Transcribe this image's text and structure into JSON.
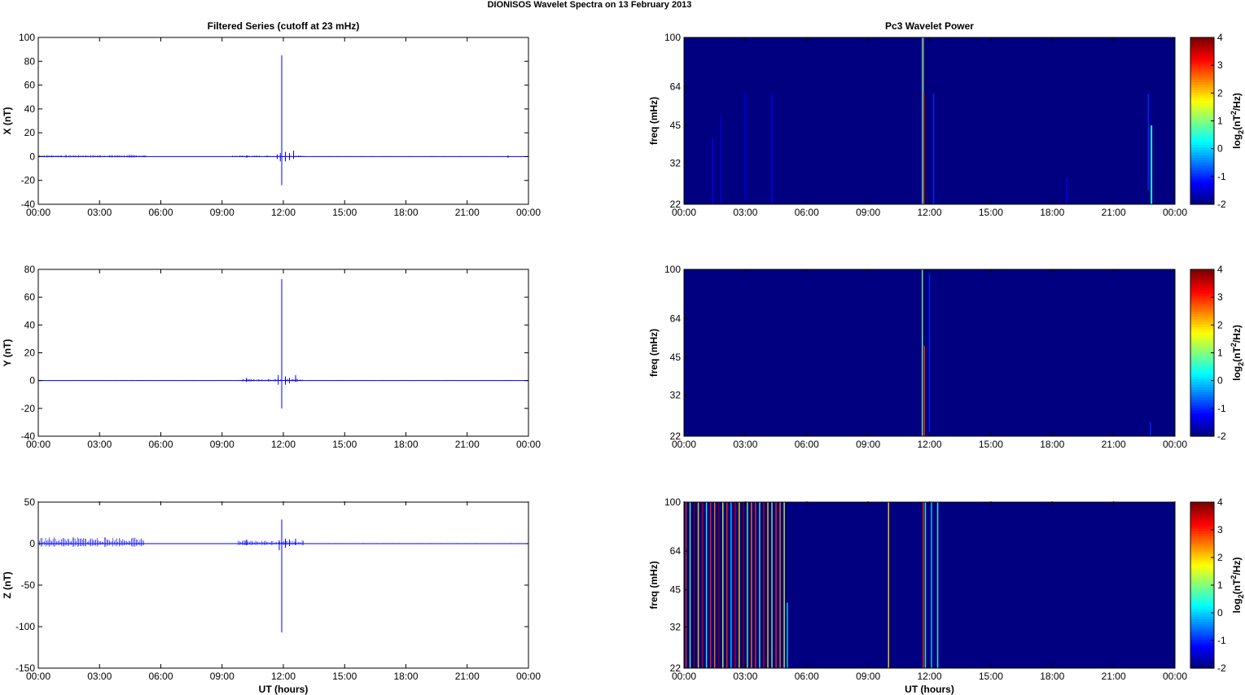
{
  "figure_title": "DIONISOS Wavelet Spectra on 13 February  2013",
  "chart_data": [
    {
      "id": "x-series",
      "type": "line",
      "title": "Filtered Series (cutoff at 23 mHz)",
      "xlabel": "",
      "ylabel": "X (nT)",
      "xlim": [
        0,
        24
      ],
      "ylim": [
        -40,
        100
      ],
      "xticks": [
        "00:00",
        "03:00",
        "06:00",
        "09:00",
        "12:00",
        "15:00",
        "18:00",
        "21:00",
        "00:00"
      ],
      "yticks": [
        -40,
        -20,
        0,
        20,
        40,
        60,
        80,
        100
      ],
      "color": "#0000ff",
      "baseline": 0,
      "spikes": [
        {
          "x": 11.92,
          "min": -24,
          "max": 85
        },
        {
          "x": 11.85,
          "min": -4,
          "max": 3
        },
        {
          "x": 12.1,
          "min": -4,
          "max": 4
        },
        {
          "x": 12.3,
          "min": -3,
          "max": 3
        },
        {
          "x": 12.5,
          "min": -2,
          "max": 5
        },
        {
          "x": 11.7,
          "min": -2,
          "max": 2
        },
        {
          "x": 10.2,
          "min": -1,
          "max": 1
        },
        {
          "x": 23.0,
          "min": -1,
          "max": 1
        }
      ],
      "noise": [
        {
          "from": 0,
          "to": 5.3,
          "amp": 1.2
        },
        {
          "from": 9.5,
          "to": 13,
          "amp": 0.8
        },
        {
          "from": 13,
          "to": 24,
          "amp": 0.3
        }
      ]
    },
    {
      "id": "y-series",
      "type": "line",
      "title": "",
      "xlabel": "",
      "ylabel": "Y (nT)",
      "xlim": [
        0,
        24
      ],
      "ylim": [
        -40,
        80
      ],
      "xticks": [
        "00:00",
        "03:00",
        "06:00",
        "09:00",
        "12:00",
        "15:00",
        "18:00",
        "21:00",
        "00:00"
      ],
      "yticks": [
        -40,
        -20,
        0,
        20,
        40,
        60,
        80
      ],
      "color": "#0000ff",
      "baseline": 0,
      "spikes": [
        {
          "x": 11.92,
          "min": -20,
          "max": 73
        },
        {
          "x": 11.75,
          "min": -3,
          "max": 4
        },
        {
          "x": 12.1,
          "min": -3,
          "max": 3
        },
        {
          "x": 12.3,
          "min": -2,
          "max": 2
        },
        {
          "x": 12.6,
          "min": -1,
          "max": 4
        },
        {
          "x": 10.2,
          "min": -1,
          "max": 2
        }
      ],
      "noise": [
        {
          "from": 0,
          "to": 24,
          "amp": 0.3
        },
        {
          "from": 10,
          "to": 13,
          "amp": 1.0
        }
      ]
    },
    {
      "id": "z-series",
      "type": "line",
      "title": "",
      "xlabel": "UT (hours)",
      "ylabel": "Z (nT)",
      "xlim": [
        0,
        24
      ],
      "ylim": [
        -150,
        50
      ],
      "xticks": [
        "00:00",
        "03:00",
        "06:00",
        "09:00",
        "12:00",
        "15:00",
        "18:00",
        "21:00",
        "00:00"
      ],
      "yticks": [
        -150,
        -100,
        -50,
        0,
        50
      ],
      "color": "#0000ff",
      "baseline": 0,
      "spikes": [
        {
          "x": 11.92,
          "min": -107,
          "max": 29
        },
        {
          "x": 11.8,
          "min": -8,
          "max": 4
        },
        {
          "x": 12.1,
          "min": -5,
          "max": 6
        },
        {
          "x": 12.3,
          "min": -3,
          "max": 5
        },
        {
          "x": 12.6,
          "min": -2,
          "max": 6
        },
        {
          "x": 10.2,
          "min": -2,
          "max": 5
        }
      ],
      "noise": [
        {
          "from": 0,
          "to": 5.2,
          "amp": 6
        },
        {
          "from": 9.8,
          "to": 13,
          "amp": 3
        },
        {
          "from": 13,
          "to": 24,
          "amp": 0.5
        }
      ]
    },
    {
      "id": "x-wavelet",
      "type": "heatmap",
      "title": "Pc3 Wavelet Power",
      "xlabel": "",
      "ylabel": "freq (mHz)",
      "xlim": [
        0,
        24
      ],
      "ylim": [
        22,
        100
      ],
      "yscale": "log",
      "xticks": [
        "00:00",
        "03:00",
        "06:00",
        "09:00",
        "12:00",
        "15:00",
        "18:00",
        "21:00",
        "00:00"
      ],
      "yticks": [
        22,
        32,
        45,
        64,
        100
      ],
      "colorbar": {
        "label": "log2(nT2/Hz)",
        "range": [
          -2,
          4
        ],
        "ticks": [
          -2,
          -1,
          0,
          1,
          2,
          3,
          4
        ]
      },
      "background": -2,
      "features": [
        {
          "x": 11.7,
          "width": 0.05,
          "fmin": 22,
          "fmax": 100,
          "level": 2.5
        },
        {
          "x": 11.75,
          "width": 0.05,
          "fmin": 22,
          "fmax": 60,
          "level": 4
        },
        {
          "x": 11.65,
          "width": 0.04,
          "fmin": 22,
          "fmax": 100,
          "level": 0
        },
        {
          "x": 12.2,
          "width": 0.06,
          "fmin": 22,
          "fmax": 60,
          "level": -1
        },
        {
          "x": 22.85,
          "width": 0.08,
          "fmin": 22,
          "fmax": 45,
          "level": 0.5
        },
        {
          "x": 22.7,
          "width": 0.06,
          "fmin": 25,
          "fmax": 60,
          "level": -1
        },
        {
          "x": 1.4,
          "width": 0.08,
          "fmin": 22,
          "fmax": 40,
          "level": -1.4
        },
        {
          "x": 1.8,
          "width": 0.06,
          "fmin": 22,
          "fmax": 50,
          "level": -1.5
        },
        {
          "x": 3.0,
          "width": 0.1,
          "fmin": 22,
          "fmax": 60,
          "level": -1.6
        },
        {
          "x": 4.3,
          "width": 0.1,
          "fmin": 22,
          "fmax": 60,
          "level": -1.6
        },
        {
          "x": 18.7,
          "width": 0.05,
          "fmin": 22,
          "fmax": 28,
          "level": -1.3
        }
      ]
    },
    {
      "id": "y-wavelet",
      "type": "heatmap",
      "title": "",
      "xlabel": "",
      "ylabel": "freq (mHz)",
      "xlim": [
        0,
        24
      ],
      "ylim": [
        22,
        100
      ],
      "yscale": "log",
      "xticks": [
        "00:00",
        "03:00",
        "06:00",
        "09:00",
        "12:00",
        "15:00",
        "18:00",
        "21:00",
        "00:00"
      ],
      "yticks": [
        22,
        32,
        45,
        64,
        100
      ],
      "colorbar": {
        "label": "log2(nT2/Hz)",
        "range": [
          -2,
          4
        ],
        "ticks": [
          -2,
          -1,
          0,
          1,
          2,
          3,
          4
        ]
      },
      "background": -2,
      "features": [
        {
          "x": 11.65,
          "width": 0.05,
          "fmin": 22,
          "fmax": 100,
          "level": 1
        },
        {
          "x": 11.75,
          "width": 0.05,
          "fmin": 22,
          "fmax": 50,
          "level": 3
        },
        {
          "x": 12.0,
          "width": 0.04,
          "fmin": 22,
          "fmax": 100,
          "level": -1
        },
        {
          "x": 22.8,
          "width": 0.05,
          "fmin": 22,
          "fmax": 25,
          "level": -1
        }
      ]
    },
    {
      "id": "z-wavelet",
      "type": "heatmap",
      "title": "",
      "xlabel": "UT (hours)",
      "ylabel": "freq (mHz)",
      "xlim": [
        0,
        24
      ],
      "ylim": [
        22,
        100
      ],
      "yscale": "log",
      "xticks": [
        "00:00",
        "03:00",
        "06:00",
        "09:00",
        "12:00",
        "15:00",
        "18:00",
        "21:00",
        "00:00"
      ],
      "yticks": [
        22,
        32,
        45,
        64,
        100
      ],
      "colorbar": {
        "label": "log2(nT2/Hz)",
        "range": [
          -2,
          4
        ],
        "ticks": [
          -2,
          -1,
          0,
          1,
          2,
          3,
          4
        ]
      },
      "background": -2,
      "features": [
        {
          "x": 0.1,
          "width": 0.05,
          "fmin": 22,
          "fmax": 100,
          "level": 3
        },
        {
          "x": 0.3,
          "width": 0.05,
          "fmin": 22,
          "fmax": 100,
          "level": 1
        },
        {
          "x": 0.5,
          "width": 0.05,
          "fmin": 22,
          "fmax": 100,
          "level": 4
        },
        {
          "x": 0.7,
          "width": 0.05,
          "fmin": 22,
          "fmax": 100,
          "level": 2
        },
        {
          "x": 0.9,
          "width": 0.05,
          "fmin": 22,
          "fmax": 100,
          "level": 3.5
        },
        {
          "x": 1.1,
          "width": 0.05,
          "fmin": 22,
          "fmax": 100,
          "level": 0.5
        },
        {
          "x": 1.3,
          "width": 0.05,
          "fmin": 22,
          "fmax": 100,
          "level": 3
        },
        {
          "x": 1.5,
          "width": 0.05,
          "fmin": 22,
          "fmax": 100,
          "level": 2.5
        },
        {
          "x": 1.7,
          "width": 0.05,
          "fmin": 22,
          "fmax": 100,
          "level": 4
        },
        {
          "x": 1.9,
          "width": 0.05,
          "fmin": 22,
          "fmax": 100,
          "level": 1.5
        },
        {
          "x": 2.1,
          "width": 0.05,
          "fmin": 22,
          "fmax": 100,
          "level": 3
        },
        {
          "x": 2.3,
          "width": 0.05,
          "fmin": 22,
          "fmax": 100,
          "level": 0
        },
        {
          "x": 2.5,
          "width": 0.05,
          "fmin": 22,
          "fmax": 100,
          "level": 3.5
        },
        {
          "x": 2.7,
          "width": 0.05,
          "fmin": 22,
          "fmax": 100,
          "level": 2
        },
        {
          "x": 2.9,
          "width": 0.05,
          "fmin": 22,
          "fmax": 100,
          "level": 4
        },
        {
          "x": 3.1,
          "width": 0.05,
          "fmin": 22,
          "fmax": 100,
          "level": 1
        },
        {
          "x": 3.3,
          "width": 0.05,
          "fmin": 22,
          "fmax": 100,
          "level": 2.5
        },
        {
          "x": 3.5,
          "width": 0.05,
          "fmin": 22,
          "fmax": 100,
          "level": 3
        },
        {
          "x": 3.7,
          "width": 0.05,
          "fmin": 22,
          "fmax": 100,
          "level": 0.5
        },
        {
          "x": 3.9,
          "width": 0.05,
          "fmin": 22,
          "fmax": 100,
          "level": 3.5
        },
        {
          "x": 4.1,
          "width": 0.05,
          "fmin": 22,
          "fmax": 100,
          "level": 2
        },
        {
          "x": 4.3,
          "width": 0.05,
          "fmin": 22,
          "fmax": 100,
          "level": 1
        },
        {
          "x": 4.5,
          "width": 0.05,
          "fmin": 22,
          "fmax": 100,
          "level": 3
        },
        {
          "x": 4.7,
          "width": 0.05,
          "fmin": 22,
          "fmax": 100,
          "level": 2.5
        },
        {
          "x": 4.9,
          "width": 0.05,
          "fmin": 22,
          "fmax": 100,
          "level": 1.5
        },
        {
          "x": 5.05,
          "width": 0.05,
          "fmin": 22,
          "fmax": 40,
          "level": 0
        },
        {
          "x": 10.0,
          "width": 0.04,
          "fmin": 22,
          "fmax": 100,
          "level": 2
        },
        {
          "x": 11.7,
          "width": 0.05,
          "fmin": 22,
          "fmax": 100,
          "level": 3
        },
        {
          "x": 11.8,
          "width": 0.04,
          "fmin": 22,
          "fmax": 100,
          "level": 0.5
        },
        {
          "x": 12.1,
          "width": 0.04,
          "fmin": 22,
          "fmax": 100,
          "level": 0
        },
        {
          "x": 12.4,
          "width": 0.05,
          "fmin": 22,
          "fmax": 100,
          "level": 0.5
        }
      ]
    }
  ]
}
